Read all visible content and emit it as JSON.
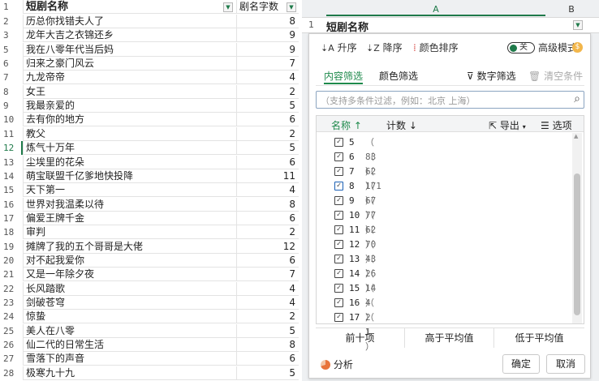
{
  "sheet": {
    "header": {
      "col_a": "短剧名称",
      "col_b": "剧名字数"
    },
    "rows": [
      {
        "n": "2",
        "name": "历总你找错夫人了",
        "count": "8"
      },
      {
        "n": "3",
        "name": "龙年大吉之衣锦还乡",
        "count": "9"
      },
      {
        "n": "5",
        "name": "我在八零年代当后妈",
        "count": "9"
      },
      {
        "n": "6",
        "name": "归来之豪门风云",
        "count": "7"
      },
      {
        "n": "7",
        "name": "九龙帝帝",
        "count": "4"
      },
      {
        "n": "8",
        "name": "女王",
        "count": "2"
      },
      {
        "n": "9",
        "name": "我最亲爱的",
        "count": "5"
      },
      {
        "n": "10",
        "name": "去有你的地方",
        "count": "6"
      },
      {
        "n": "11",
        "name": "教父",
        "count": "2"
      },
      {
        "n": "12",
        "name": "炼气十万年",
        "count": "5"
      },
      {
        "n": "13",
        "name": "尘埃里的花朵",
        "count": "6"
      },
      {
        "n": "14",
        "name": "萌宝联盟千亿爹地快投降",
        "count": "11"
      },
      {
        "n": "15",
        "name": "天下第一",
        "count": "4"
      },
      {
        "n": "16",
        "name": "世界对我温柔以待",
        "count": "8"
      },
      {
        "n": "17",
        "name": "偏爱王牌千金",
        "count": "6"
      },
      {
        "n": "18",
        "name": "审判",
        "count": "2"
      },
      {
        "n": "19",
        "name": "摊牌了我的五个哥哥是大佬",
        "count": "12"
      },
      {
        "n": "20",
        "name": "对不起我爱你",
        "count": "6"
      },
      {
        "n": "21",
        "name": "又是一年除夕夜",
        "count": "7"
      },
      {
        "n": "22",
        "name": "长风踏歌",
        "count": "4"
      },
      {
        "n": "23",
        "name": "剑破苍穹",
        "count": "4"
      },
      {
        "n": "24",
        "name": "惊蛰",
        "count": "2"
      },
      {
        "n": "25",
        "name": "美人在八零",
        "count": "5"
      },
      {
        "n": "26",
        "name": "仙二代的日常生活",
        "count": "8"
      },
      {
        "n": "27",
        "name": "雪落下的声音",
        "count": "6"
      },
      {
        "n": "28",
        "name": "极寒九十九",
        "count": "5"
      }
    ]
  },
  "right_sheet": {
    "col_a": "A",
    "col_b": "B",
    "row1_num": "1",
    "row1_a": "短剧名称"
  },
  "filter": {
    "sort_asc": "升序",
    "sort_desc": "降序",
    "sort_color": "颜色排序",
    "toggle_label": "关",
    "advanced_mode": "高级模式",
    "tab_content": "内容筛选",
    "tab_color": "颜色筛选",
    "number_filter": "数字筛选",
    "clear_filter": "清空条件",
    "search_placeholder": "（支持多条件过滤，例如：北京 上海）",
    "col_name": "名称",
    "col_count": "计数",
    "export": "导出",
    "options": "选项",
    "items": [
      {
        "label": "5",
        "count": "（ 83 ）",
        "checked": true
      },
      {
        "label": "6",
        "count": "（ 62 ）",
        "checked": true
      },
      {
        "label": "7",
        "count": "（ 171 ）",
        "checked": true
      },
      {
        "label": "8",
        "count": "（ 67 ）",
        "checked": true
      },
      {
        "label": "9",
        "count": "（ 77 ）",
        "checked": true
      },
      {
        "label": "10",
        "count": "（ 62 ）",
        "checked": true
      },
      {
        "label": "11",
        "count": "（ 70 ）",
        "checked": true
      },
      {
        "label": "12",
        "count": "（ 43 ）",
        "checked": true
      },
      {
        "label": "13",
        "count": "（ 26 ）",
        "checked": true
      },
      {
        "label": "14",
        "count": "（ 14 ）",
        "checked": true
      },
      {
        "label": "15",
        "count": "（ 4 ）",
        "checked": true
      },
      {
        "label": "16",
        "count": "（ 2 ）",
        "checked": true
      },
      {
        "label": "17",
        "count": "（ 1 ）",
        "checked": true
      }
    ],
    "top10": "前十项",
    "above_avg": "高于平均值",
    "below_avg": "低于平均值",
    "analysis": "分析",
    "ok": "确定",
    "cancel": "取消"
  },
  "colors": {
    "accent": "#1f7a4a",
    "tab_active": "#1f8a4c"
  }
}
